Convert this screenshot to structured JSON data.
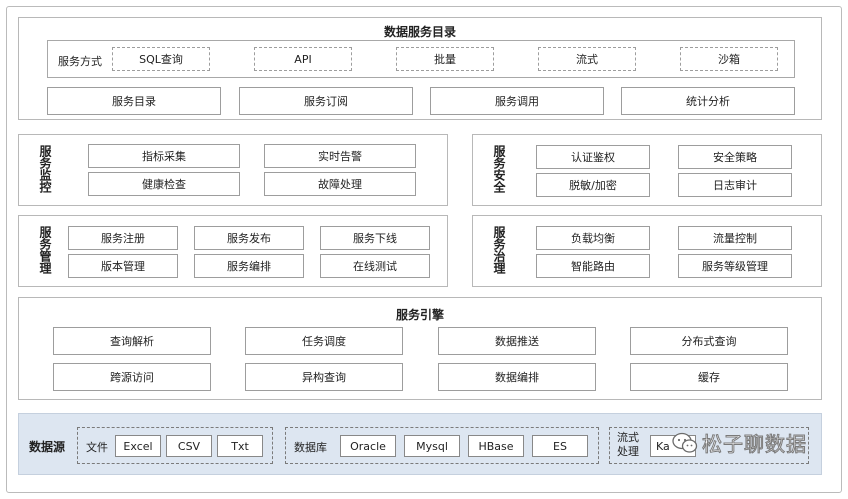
{
  "catalog": {
    "title": "数据服务目录",
    "modes_label": "服务方式",
    "modes": [
      "SQL查询",
      "API",
      "批量",
      "流式",
      "沙箱"
    ],
    "items": [
      "服务目录",
      "服务订阅",
      "服务调用",
      "统计分析"
    ]
  },
  "monitor": {
    "label": "服务监控",
    "items": [
      "指标采集",
      "实时告警",
      "健康检查",
      "故障处理"
    ]
  },
  "security": {
    "label": "服务安全",
    "items": [
      "认证鉴权",
      "安全策略",
      "脱敏/加密",
      "日志审计"
    ]
  },
  "manage": {
    "label": "服务管理",
    "items": [
      "服务注册",
      "服务发布",
      "服务下线",
      "版本管理",
      "服务编排",
      "在线测试"
    ]
  },
  "govern": {
    "label": "服务治理",
    "items": [
      "负载均衡",
      "流量控制",
      "智能路由",
      "服务等级管理"
    ]
  },
  "engine": {
    "title": "服务引擎",
    "items": [
      "查询解析",
      "任务调度",
      "数据推送",
      "分布式查询",
      "跨源访问",
      "异构查询",
      "数据编排",
      "缓存"
    ]
  },
  "sources": {
    "label": "数据源",
    "file": {
      "label": "文件",
      "items": [
        "Excel",
        "CSV",
        "Txt"
      ]
    },
    "db": {
      "label": "数据库",
      "items": [
        "Oracle",
        "Mysql",
        "HBase",
        "ES"
      ]
    },
    "stream": {
      "label": "流式处理",
      "items": [
        "Ka"
      ]
    }
  },
  "watermark": "松子聊数据"
}
